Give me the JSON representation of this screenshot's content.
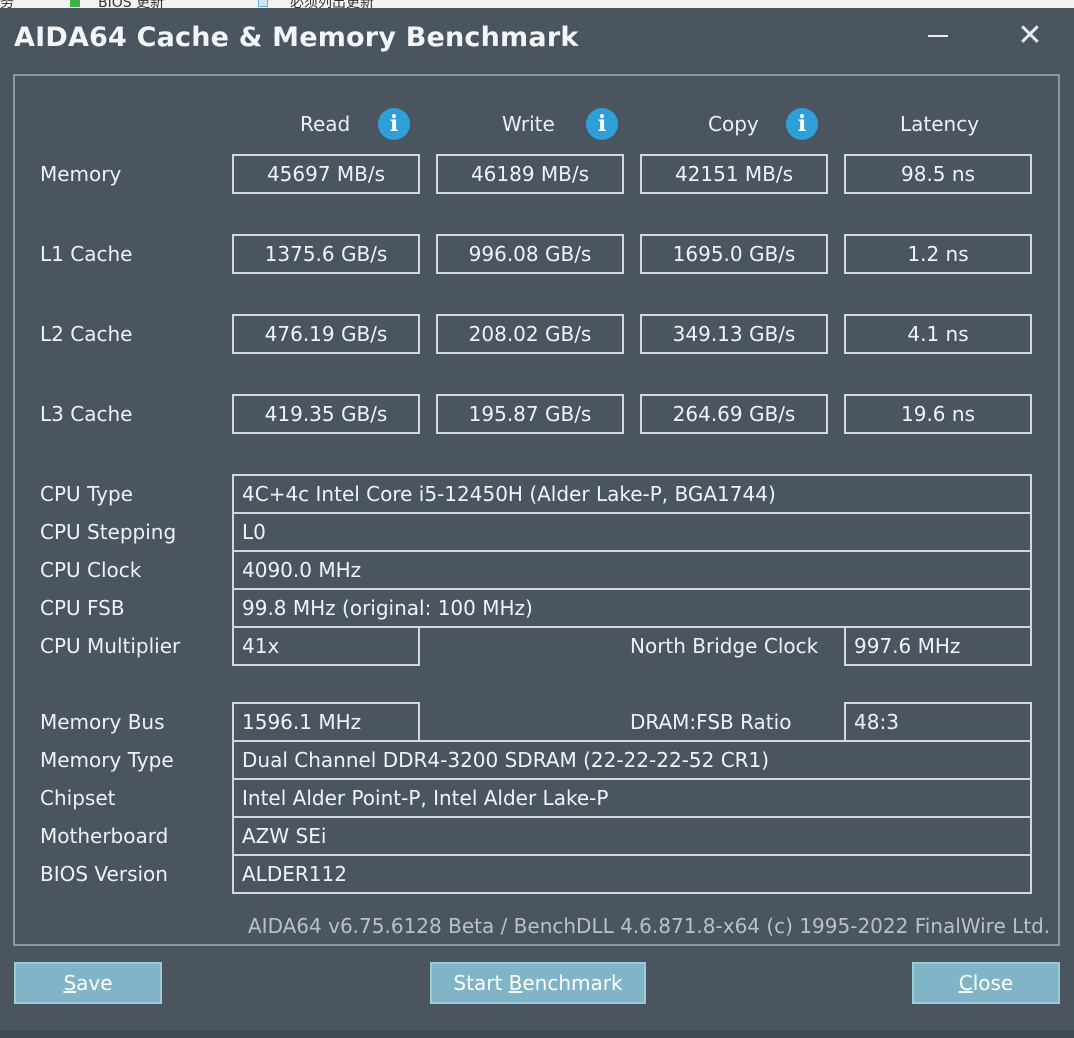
{
  "taskbar": {
    "item1": "务",
    "item2": "BIOS 更新",
    "item3": "必须列出更新"
  },
  "window": {
    "title": "AIDA64 Cache & Memory Benchmark"
  },
  "columns": {
    "read": "Read",
    "write": "Write",
    "copy": "Copy",
    "latency": "Latency"
  },
  "rows": [
    {
      "label": "Memory",
      "read": "45697 MB/s",
      "write": "46189 MB/s",
      "copy": "42151 MB/s",
      "latency": "98.5 ns"
    },
    {
      "label": "L1 Cache",
      "read": "1375.6 GB/s",
      "write": "996.08 GB/s",
      "copy": "1695.0 GB/s",
      "latency": "1.2 ns"
    },
    {
      "label": "L2 Cache",
      "read": "476.19 GB/s",
      "write": "208.02 GB/s",
      "copy": "349.13 GB/s",
      "latency": "4.1 ns"
    },
    {
      "label": "L3 Cache",
      "read": "419.35 GB/s",
      "write": "195.87 GB/s",
      "copy": "264.69 GB/s",
      "latency": "19.6 ns"
    }
  ],
  "cpu": {
    "type_label": "CPU Type",
    "type_value": "4C+4c Intel Core i5-12450H  (Alder Lake-P, BGA1744)",
    "stepping_label": "CPU Stepping",
    "stepping_value": "L0",
    "clock_label": "CPU Clock",
    "clock_value": "4090.0 MHz",
    "fsb_label": "CPU FSB",
    "fsb_value": "99.8 MHz  (original: 100 MHz)",
    "multiplier_label": "CPU Multiplier",
    "multiplier_value": "41x",
    "nb_clock_label": "North Bridge Clock",
    "nb_clock_value": "997.6 MHz"
  },
  "memory": {
    "bus_label": "Memory Bus",
    "bus_value": "1596.1 MHz",
    "ratio_label": "DRAM:FSB Ratio",
    "ratio_value": "48:3",
    "type_label": "Memory Type",
    "type_value": "Dual Channel DDR4-3200 SDRAM  (22-22-22-52 CR1)",
    "chipset_label": "Chipset",
    "chipset_value": "Intel Alder Point-P, Intel Alder Lake-P",
    "motherboard_label": "Motherboard",
    "motherboard_value": "AZW SEi",
    "bios_label": "BIOS Version",
    "bios_value": "ALDER112"
  },
  "footer": "AIDA64 v6.75.6128 Beta / BenchDLL 4.6.871.8-x64  (c) 1995-2022 FinalWire Ltd.",
  "buttons": {
    "save_first": "S",
    "save_rest": "ave",
    "start_pre": "Start ",
    "start_ul": "B",
    "start_rest": "enchmark",
    "close_first": "C",
    "close_rest": "lose"
  },
  "colors": {
    "background": "#4a5560",
    "info_icon": "#2f9fd8",
    "button": "#7fb5c6"
  },
  "icons": {
    "info": "info-icon",
    "minimize": "minimize-icon",
    "close": "close-icon"
  }
}
